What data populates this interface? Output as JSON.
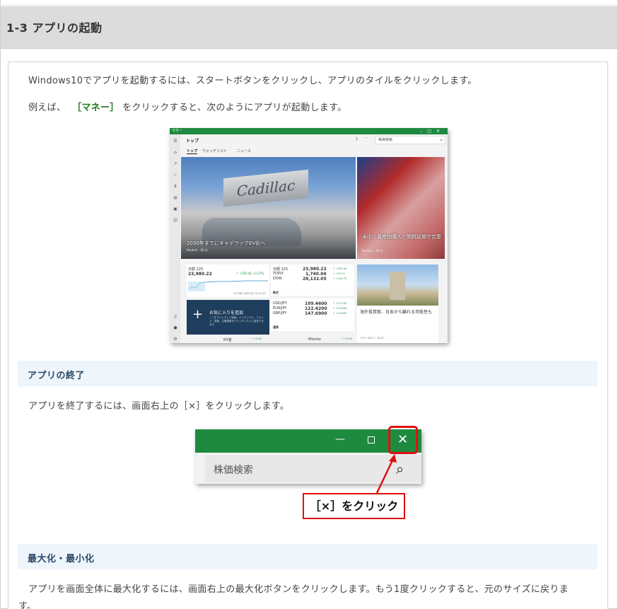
{
  "section": {
    "title": "1-3 アプリの起動"
  },
  "intro": {
    "line1": "Windows10でアプリを起動するには、スタートボタンをクリックし、アプリのタイルをクリックします。",
    "line2_prefix": "例えば、",
    "line2_highlight": "［マネー］",
    "line2_suffix": "をクリックすると、次のようにアプリが起動します。"
  },
  "money_app": {
    "window_title": "マネー",
    "page_title": "トップ",
    "search_placeholder": "株価検索",
    "tabs": [
      "トップ",
      "ウォッチリスト",
      "ニュース"
    ],
    "hero_caption": "2030年までにキャデラックEV化へ",
    "hero_source": "Reuters · 30 分",
    "hero_sign": "Cadillac",
    "hero2_caption": "米中、農産物購入と関税延期で合意",
    "hero2_source": "Reuters · 26 分",
    "index_card": {
      "name": "日経 225",
      "value": "23,980.22",
      "change": "↑ +555.45  +2.37%",
      "date": "2019年12月13日 15:15 JST"
    },
    "indices": [
      {
        "name": "日経 225",
        "value": "23,980.22",
        "change": "↑ +555.45"
      },
      {
        "name": "TOPIX",
        "value": "1,740.04",
        "change": "↑ +27.21"
      },
      {
        "name": "DOW",
        "value": "28,132.05",
        "change": "↑ +220.75"
      }
    ],
    "label_stocks": "株式",
    "fx": [
      {
        "name": "USD/JPY",
        "value": "109.4600",
        "change": "↑ +0.1700"
      },
      {
        "name": "EUR/JPY",
        "value": "122.4200",
        "change": "↑ +0.0000"
      },
      {
        "name": "GBP/JPY",
        "value": "147.6900",
        "change": "↑ +2.4400"
      }
    ],
    "label_fx": "通貨",
    "add_title": "お気に入りを追加",
    "add_desc": "ここをクリックして銘柄、インデックス、ファンド、為替、主要指数をウォッチリストに追加できます",
    "news2_caption": "海外投資家、日本から離れる可能性も",
    "news2_source": "ミセーボロジ · 38 分",
    "bottom_left": "NY金",
    "bottom_mid": "Mizuho",
    "bottom_change": "↑ +0.00"
  },
  "exit_section": {
    "title": "アプリの終了",
    "text": "アプリを終了するには、画面右上の［×］をクリックします。",
    "search_label": "株価検索",
    "callout": "［×］をクリック"
  },
  "max_section": {
    "title": "最大化・最小化",
    "text_line1": "アプリを画面全体に最大化するには、画面右上の最大化ボタンをクリックします。もう1度クリックすると、元のサイズに戻りま",
    "text_line2": "す。"
  },
  "colors": {
    "app_green": "#1e8a3f",
    "highlight_red": "#e01010",
    "highlight_green": "#1a7a1a"
  }
}
